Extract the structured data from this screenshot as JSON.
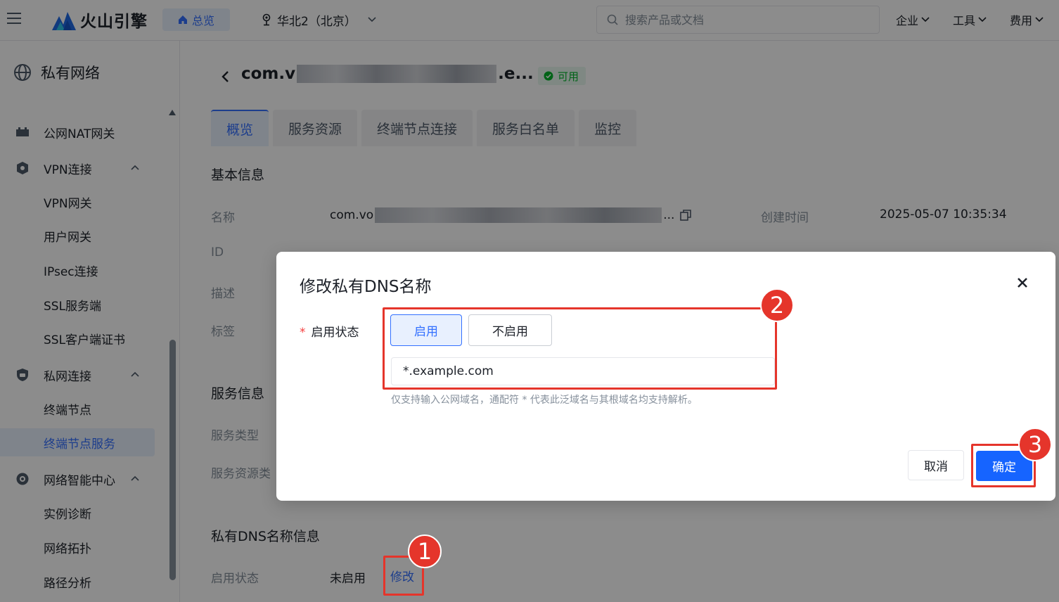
{
  "topbar": {
    "brand": "火山引擎",
    "overview": "总览",
    "region": "华北2（北京）",
    "search_placeholder": "搜索产品或文档",
    "nav": [
      "企业",
      "工具",
      "费用"
    ]
  },
  "sidebar": {
    "title": "私有网络",
    "items": [
      {
        "label": "公网NAT网关",
        "icon": "nat-gateway-icon"
      },
      {
        "label": "VPN连接",
        "icon": "vpn-icon",
        "expanded": true
      },
      {
        "label": "VPN网关"
      },
      {
        "label": "用户网关"
      },
      {
        "label": "IPsec连接"
      },
      {
        "label": "SSL服务端"
      },
      {
        "label": "SSL客户端证书"
      },
      {
        "label": "私网连接",
        "icon": "private-link-icon",
        "expanded": true
      },
      {
        "label": "终端节点"
      },
      {
        "label": "终端节点服务",
        "active": true
      },
      {
        "label": "网络智能中心",
        "icon": "network-intelligence-icon",
        "expanded": true
      },
      {
        "label": "实例诊断"
      },
      {
        "label": "网络拓扑"
      },
      {
        "label": "路径分析"
      }
    ]
  },
  "detail": {
    "title_prefix": "com.v",
    "title_suffix": ".e...",
    "status": "可用",
    "tabs": [
      "概览",
      "服务资源",
      "终端节点连接",
      "服务白名单",
      "监控"
    ],
    "basic_info_title": "基本信息",
    "fields": {
      "name_label": "名称",
      "name_value_prefix": "com.vo",
      "name_value_suffix": "...",
      "id_label": "ID",
      "desc_label": "描述",
      "tag_label": "标签",
      "created_label": "创建时间",
      "created_value": "2025-05-07 10:35:34"
    },
    "service_info_title": "服务信息",
    "service_type_label": "服务类型",
    "service_resource_label": "服务资源类",
    "dns_info_title": "私有DNS名称信息",
    "dns_status_label": "启用状态",
    "dns_status_value": "未启用",
    "modify_link": "修改"
  },
  "modal": {
    "title": "修改私有DNS名称",
    "field_label": "启用状态",
    "required_mark": "*",
    "option_on": "启用",
    "option_off": "不启用",
    "selected": "启用",
    "dns_value": "*.example.com",
    "hint": "仅支持输入公网域名，通配符 * 代表此泛域名与其根域名均支持解析。",
    "cancel": "取消",
    "confirm": "确定"
  },
  "annotations": [
    "1",
    "2",
    "3"
  ],
  "colors": {
    "accent": "#3370ff",
    "primary_button": "#1664ff",
    "annotation_red": "#e5352b",
    "status_green": "#00b42a"
  }
}
